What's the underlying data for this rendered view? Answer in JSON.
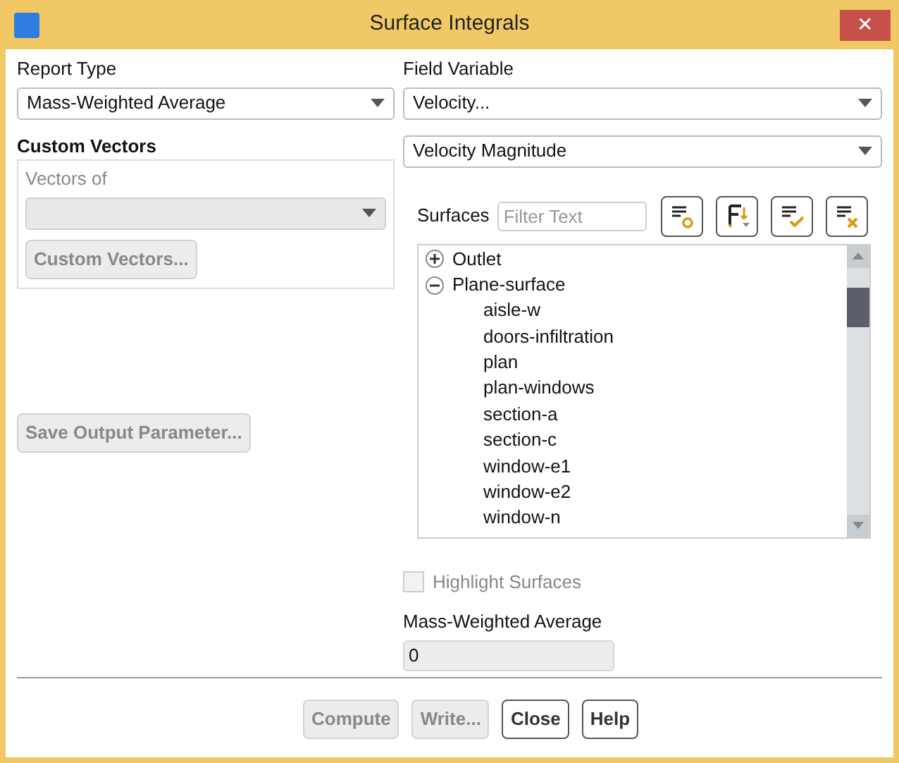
{
  "window": {
    "title": "Surface Integrals",
    "close": "✕"
  },
  "report_type": {
    "label": "Report Type",
    "value": "Mass-Weighted Average"
  },
  "custom_vectors": {
    "title": "Custom Vectors",
    "vectors_of": {
      "label": "Vectors of",
      "disabled": true
    },
    "button": {
      "label": "Custom Vectors...",
      "disabled": true
    }
  },
  "save_output": {
    "label": "Save Output Parameter...",
    "disabled": true
  },
  "field_variable": {
    "label": "Field Variable",
    "value": "Velocity...",
    "sub_value": "Velocity Magnitude"
  },
  "surfaces": {
    "label": "Surfaces",
    "placeholder": "Filter Text",
    "tree": [
      {
        "label": "Outlet",
        "expanded": false
      },
      {
        "label": "Plane-surface",
        "expanded": true,
        "children": [
          {
            "label": "aisle-w"
          },
          {
            "label": "doors-infiltration"
          },
          {
            "label": "plan"
          },
          {
            "label": "plan-windows"
          },
          {
            "label": "section-a"
          },
          {
            "label": "section-c"
          },
          {
            "label": "window-e1"
          },
          {
            "label": "window-e2"
          },
          {
            "label": "window-n"
          }
        ]
      }
    ]
  },
  "highlight_surfaces": {
    "label": "Highlight Surfaces",
    "checked": false,
    "disabled": true
  },
  "result": {
    "label": "Mass-Weighted Average",
    "value": "0"
  },
  "buttons": [
    {
      "label": "Compute",
      "disabled": true
    },
    {
      "label": "Write...",
      "disabled": true
    },
    {
      "label": "Close",
      "disabled": false
    },
    {
      "label": "Help",
      "disabled": false
    }
  ]
}
